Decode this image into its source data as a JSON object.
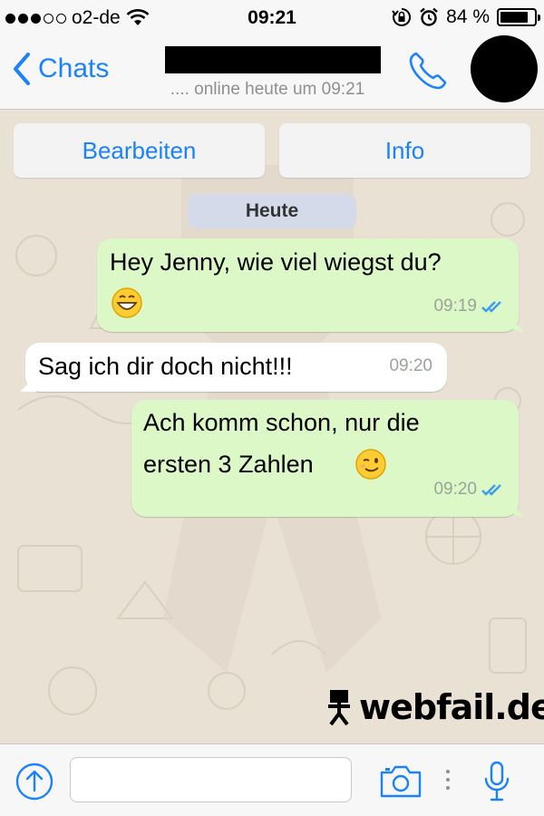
{
  "status_bar": {
    "carrier": "o2-de",
    "signal_filled": 3,
    "signal_total": 5,
    "time": "09:21",
    "battery_text": "84 %",
    "battery_level": 0.84
  },
  "header": {
    "back_label": "Chats",
    "contact_status": ".... online heute um 09:21"
  },
  "actions": {
    "edit_label": "Bearbeiten",
    "info_label": "Info"
  },
  "date_separator": "Heute",
  "messages": [
    {
      "direction": "outgoing",
      "lines": [
        "Hey Jenny, wie viel wiegst du?"
      ],
      "emoji": "grinning-face",
      "time": "09:19",
      "status": "read"
    },
    {
      "direction": "incoming",
      "lines": [
        "Sag ich dir doch nicht!!!"
      ],
      "time": "09:20"
    },
    {
      "direction": "outgoing",
      "lines": [
        "Ach komm schon, nur die",
        "ersten 3 Zahlen"
      ],
      "emoji": "winking-face",
      "time": "09:20",
      "status": "read"
    }
  ],
  "watermark": "webfail.de",
  "input": {
    "placeholder": ""
  },
  "colors": {
    "accent": "#1a82fb",
    "outgoing_bubble": "#dcf8c6",
    "incoming_bubble": "#ffffff",
    "read_ticks": "#3b9df0",
    "wallpaper": "#e9e1d3"
  }
}
